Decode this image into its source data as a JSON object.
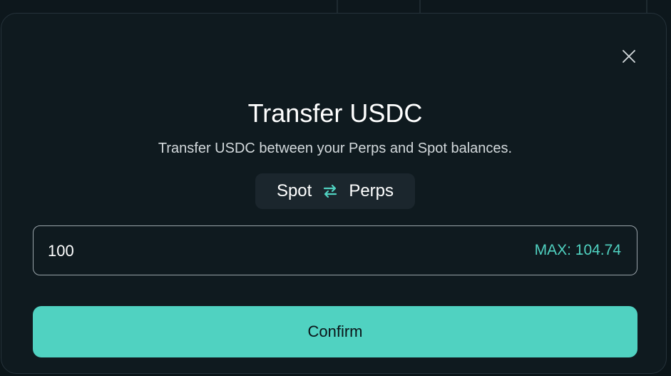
{
  "modal": {
    "title": "Transfer USDC",
    "subtitle": "Transfer USDC between your Perps and Spot balances."
  },
  "transfer_toggle": {
    "from_label": "Spot",
    "to_label": "Perps",
    "icon": "swap-arrows-icon"
  },
  "amount": {
    "value": "100",
    "max_label": "MAX: 104.74"
  },
  "actions": {
    "confirm_label": "Confirm",
    "close_icon": "close-icon"
  },
  "colors": {
    "accent": "#50d2c1",
    "modal_background": "#0f1a1f",
    "toggle_background": "#1b262d"
  }
}
